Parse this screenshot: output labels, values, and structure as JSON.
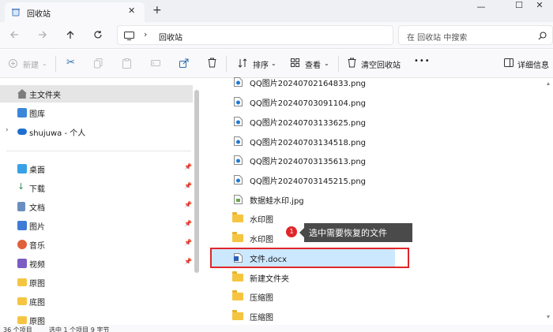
{
  "window": {
    "tab_title": "回收站",
    "new_tab": "+",
    "close_tab": "✕",
    "minimize": "—",
    "maximize": "☐",
    "close": "✕"
  },
  "address": {
    "path_separator": "›",
    "path": "回收站",
    "search_placeholder": "在 回收站 中搜索",
    "icons": [
      "back-arrow-icon",
      "forward-arrow-icon",
      "up-arrow-icon",
      "refresh-icon",
      "monitor-icon",
      "search-icon"
    ]
  },
  "toolbar": {
    "new_label": "新建",
    "sort_label": "排序",
    "view_label": "查看",
    "empty_bin_label": "清空回收站",
    "more_label": "•••",
    "details_label": "详细信息"
  },
  "sidebar": {
    "items": [
      {
        "label": "主文件夹",
        "icon": "home-icon",
        "color": "#7d7d7d"
      },
      {
        "label": "图库",
        "icon": "gallery-icon",
        "color": "#3a86d9"
      },
      {
        "label": "shujuwa - 个人",
        "icon": "cloud-icon",
        "color": "#1f6fd1"
      },
      {
        "label": "桌面",
        "icon": "desktop-icon",
        "color": "#3aa0e6"
      },
      {
        "label": "下载",
        "icon": "download-icon",
        "color": "#2f8f5b"
      },
      {
        "label": "文档",
        "icon": "document-icon",
        "color": "#6c8ebf"
      },
      {
        "label": "图片",
        "icon": "pictures-icon",
        "color": "#3e7bd6"
      },
      {
        "label": "音乐",
        "icon": "music-icon",
        "color": "#e0603a"
      },
      {
        "label": "视频",
        "icon": "video-icon",
        "color": "#7b5cc4"
      },
      {
        "label": "原图",
        "icon": "folder-icon",
        "color": "#f5c542"
      },
      {
        "label": "底图",
        "icon": "folder-icon",
        "color": "#f5c542"
      },
      {
        "label": "原图",
        "icon": "folder-icon",
        "color": "#f5c542"
      }
    ]
  },
  "files": [
    {
      "name": "QQ图片20240702164833.png",
      "type": "image"
    },
    {
      "name": "QQ图片20240703091104.png",
      "type": "image"
    },
    {
      "name": "QQ图片20240703133625.png",
      "type": "image"
    },
    {
      "name": "QQ图片20240703134518.png",
      "type": "image"
    },
    {
      "name": "QQ图片20240703135613.png",
      "type": "image"
    },
    {
      "name": "QQ图片20240703145215.png",
      "type": "image"
    },
    {
      "name": "数据蛙水印.jpg",
      "type": "image"
    },
    {
      "name": "水印图",
      "type": "folder"
    },
    {
      "name": "水印图",
      "type": "folder"
    },
    {
      "name": "文件.docx",
      "type": "word"
    },
    {
      "name": "新建文件夹",
      "type": "folder"
    },
    {
      "name": "压缩图",
      "type": "folder"
    },
    {
      "name": "压缩图",
      "type": "folder"
    }
  ],
  "annotation": {
    "step": "1",
    "text": "选中需要恢复的文件",
    "accent": "#e0262a"
  },
  "status": {
    "count": "36 个项目",
    "selection": "选中 1 个项目 9 字节"
  }
}
